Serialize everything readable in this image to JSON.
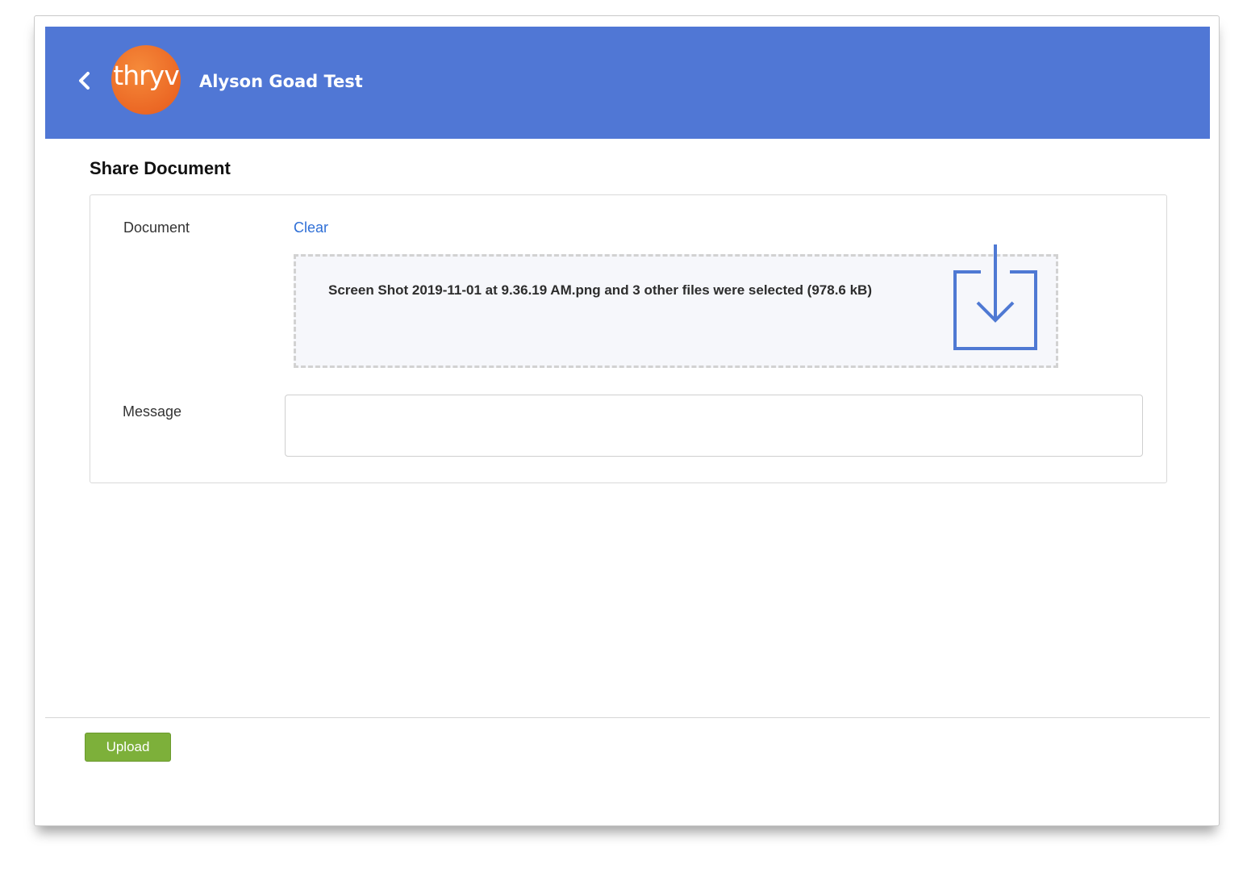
{
  "header": {
    "back_icon": "chevron-left-icon",
    "logo_text": "thryv",
    "account_name": "Alyson Goad Test",
    "background_color": "#5077d5",
    "logo_color": "#ec6a26"
  },
  "page": {
    "title": "Share Document"
  },
  "form": {
    "document_label": "Document",
    "clear_label": "Clear",
    "dropzone_text": "Screen Shot 2019-11-01 at 9.36.19 AM.png and 3 other files were selected (978.6 kB)",
    "dropzone_icon": "download-icon",
    "message_label": "Message",
    "message_value": "",
    "message_placeholder": ""
  },
  "footer": {
    "upload_label": "Upload",
    "upload_color": "#7db03a"
  }
}
